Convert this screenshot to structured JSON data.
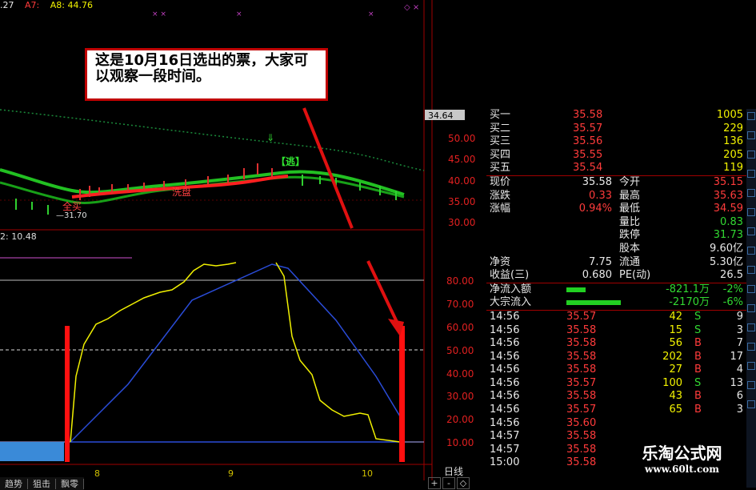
{
  "top_bar": {
    "a": ".27",
    "a7": "A7:",
    "a8": "A8: 44.76"
  },
  "callout": {
    "text": "这是10月16日选出的票，大家可以观察一段时间。"
  },
  "price_chart": {
    "y_labels": [
      "50.00",
      "45.00",
      "40.00",
      "35.00",
      "30.00"
    ],
    "price_box": "34.64",
    "signal_escape": "【逃】",
    "signal_wash": "洗盘",
    "signal_buy": "全买",
    "low_label": "—31.70"
  },
  "indicator": {
    "label": "2: 10.48",
    "y_labels": [
      "80.00",
      "70.00",
      "60.00",
      "50.00",
      "40.00",
      "30.00",
      "20.00",
      "10.00"
    ]
  },
  "x_axis": {
    "labels": [
      "8",
      "9",
      "10"
    ],
    "period": "日线"
  },
  "bottom_tabs": [
    "趋势",
    "狙击",
    "飘零"
  ],
  "zoom": [
    "+",
    "-",
    "◇"
  ],
  "quote": {
    "bids": [
      {
        "label": "买一",
        "price": "35.58",
        "vol": "1005"
      },
      {
        "label": "买二",
        "price": "35.57",
        "vol": "229"
      },
      {
        "label": "买三",
        "price": "35.56",
        "vol": "136"
      },
      {
        "label": "买四",
        "price": "35.55",
        "vol": "205"
      },
      {
        "label": "买五",
        "price": "35.54",
        "vol": "119"
      }
    ],
    "stats": [
      {
        "l1": "现价",
        "v1": "35.58",
        "l2": "今开",
        "v2": "35.15"
      },
      {
        "l1": "涨跌",
        "v1": "0.33",
        "l2": "最高",
        "v2": "35.63"
      },
      {
        "l1": "涨幅",
        "v1": "0.94%",
        "l2": "最低",
        "v2": "34.59"
      },
      {
        "l1": "",
        "v1": "",
        "l2": "量比",
        "v2": "0.83"
      },
      {
        "l1": "",
        "v1": "",
        "l2": "跌停",
        "v2": "31.73"
      },
      {
        "l1": "",
        "v1": "",
        "l2": "股本",
        "v2": "9.60亿"
      },
      {
        "l1": "净资",
        "v1": "7.75",
        "l2": "流通",
        "v2": "5.30亿"
      },
      {
        "l1": "收益(三)",
        "v1": "0.680",
        "l2": "PE(动)",
        "v2": "26.5"
      }
    ],
    "flows": [
      {
        "label": "净流入额",
        "value": "-821.1万",
        "pct": "-2%",
        "bar": 0.3
      },
      {
        "label": "大宗流入",
        "value": "-2170万",
        "pct": "-6%",
        "bar": 0.85
      }
    ],
    "ticks": [
      {
        "time": "14:56",
        "price": "35.57",
        "vol": "42",
        "side": "S",
        "n": "9"
      },
      {
        "time": "14:56",
        "price": "35.58",
        "vol": "15",
        "side": "S",
        "n": "3"
      },
      {
        "time": "14:56",
        "price": "35.58",
        "vol": "56",
        "side": "B",
        "n": "7"
      },
      {
        "time": "14:56",
        "price": "35.58",
        "vol": "202",
        "side": "B",
        "n": "17"
      },
      {
        "time": "14:56",
        "price": "35.58",
        "vol": "27",
        "side": "B",
        "n": "4"
      },
      {
        "time": "14:56",
        "price": "35.57",
        "vol": "100",
        "side": "S",
        "n": "13"
      },
      {
        "time": "14:56",
        "price": "35.58",
        "vol": "43",
        "side": "B",
        "n": "6"
      },
      {
        "time": "14:56",
        "price": "35.57",
        "vol": "65",
        "side": "B",
        "n": "3"
      },
      {
        "time": "14:56",
        "price": "35.60",
        "vol": "",
        "side": "",
        "n": ""
      },
      {
        "time": "14:57",
        "price": "35.58",
        "vol": "",
        "side": "",
        "n": ""
      },
      {
        "time": "14:57",
        "price": "35.58",
        "vol": "",
        "side": "",
        "n": ""
      },
      {
        "time": "15:00",
        "price": "35.58",
        "vol": "",
        "side": "",
        "n": ""
      }
    ]
  },
  "watermark": {
    "title": "乐淘公式网",
    "url": "www.60lt.com"
  },
  "colors": {
    "price_up": "#ff3b3b",
    "yellow": "#f2f200",
    "green": "#32d832",
    "blue_line": "#2a4cd8",
    "arrow_red": "#e01010"
  }
}
